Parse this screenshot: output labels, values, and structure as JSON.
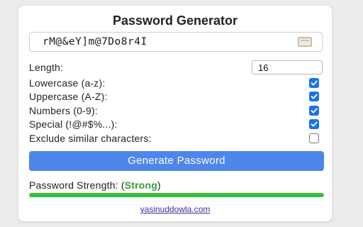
{
  "app": {
    "title": "Password Generator"
  },
  "password": {
    "value": "rM@&eY]m@7Do8r4I",
    "copy_icon": "clipboard-icon"
  },
  "length": {
    "label": "Length:",
    "value": "16"
  },
  "options": [
    {
      "label": "Lowercase (a-z):",
      "checked": true
    },
    {
      "label": "Uppercase (A-Z):",
      "checked": true
    },
    {
      "label": "Numbers (0-9):",
      "checked": true
    },
    {
      "label": "Special (!@#$%...):",
      "checked": true
    },
    {
      "label": "Exclude similar characters:",
      "checked": false
    }
  ],
  "generate_button": {
    "label": "Generate Password"
  },
  "strength": {
    "label": "Password Strength: (",
    "value": "Strong",
    "suffix": ")",
    "fill_fraction": 1.0,
    "color": "#3bbd3b"
  },
  "footer": {
    "link_text": "yasinuddowla.com"
  },
  "colors": {
    "accent": "#1a73e8",
    "button": "#4f86ec",
    "strength_text": "#3a9a3a"
  }
}
